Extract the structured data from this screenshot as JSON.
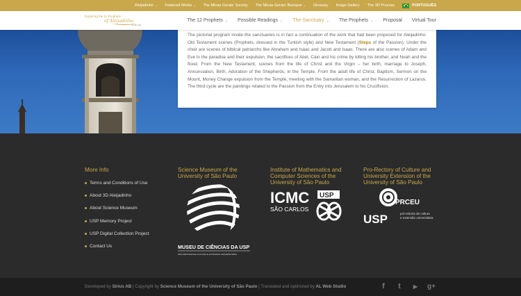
{
  "topbar": {
    "items": [
      {
        "label": "Aleijadinho",
        "caret": "⌄"
      },
      {
        "label": "Featured Works",
        "caret": "⌄"
      },
      {
        "label": "The Minas Gerais' Society",
        "caret": ""
      },
      {
        "label": "The Minas Gerais' Baroque",
        "caret": "⌄"
      },
      {
        "label": "Glossary",
        "caret": ""
      },
      {
        "label": "Image Gallery",
        "caret": ""
      },
      {
        "label": "The 3D Process",
        "caret": ""
      }
    ],
    "language": "PORTUGUÊS"
  },
  "logo": {
    "line1": "Exploring the 12 Prophets",
    "line2": "of Aleijadinho",
    "line3": "in 3D web"
  },
  "nav": {
    "items": [
      {
        "label": "The 12 Prophets",
        "caret": "⌄",
        "active": false
      },
      {
        "label": "Possible Readings",
        "caret": "⌄",
        "active": false
      },
      {
        "label": "The Sanctuary",
        "caret": "⌄",
        "active": true
      },
      {
        "label": "The Prophets",
        "caret": "⌄",
        "active": false
      },
      {
        "label": "Proposal",
        "caret": "",
        "active": false
      },
      {
        "label": "Virtual Tour",
        "caret": "",
        "active": false
      }
    ]
  },
  "content": {
    "before_steps": "The pictorial program inside the sanctuaries is in fact a continuation of the work that had been proposed for Aleijadinho: Old Testament scenes (Prophets, dressed in the Turkish style) and New Testament (",
    "steps": "Steps",
    "after_steps": " of the Passion). Under the choir are scenes of biblical patriarchs like Abraham and Isaac and Jacob and Isaac. There are also scenes of Adam and Eve in the paradise and their expulsion, the sacrifices of Abel, Cain and his crime by killing his brother, and Noah and the flood. From the New Testament, scenes from the life of Christ and the Virgin – her birth, marriage to Joseph, Annunciation, Birth, Adoration of the Shepherds, in the Temple. From the adult life of Christ, Baptism, Sermon on the Mount, Money Change expulsion from the Temple, meeting with the Samaritan woman, and the Resurrection of Lazarus. The third cycle are the paintings related to the Passion from the Entry into Jerusalem to his Crucifixion."
  },
  "footer": {
    "more_info": {
      "title": "More Info",
      "links": [
        "Terms and Conditions of Use",
        "About 3D Aleijadinho",
        "About Science Museum",
        "USP Memory Project",
        "USP Digital Collection Project",
        "Contact Us"
      ]
    },
    "museum": {
      "title": "Science Museum of the University of São Paulo",
      "logo_main": "MUSEU DE CIÊNCIAS DA USP",
      "logo_sub": "PRÓ-REITORIA DE CULTURA E EXTENSÃO UNIVERSITÁRIA"
    },
    "icmc": {
      "title": "Institute of Mathematics and Computer Sciences of the University of São Paulo",
      "logo_main": "ICMC",
      "logo_usp": "USP",
      "logo_sub": "SÃO CARLOS"
    },
    "prceu": {
      "title": "Pro-Rectory of Culture and University Extension of the University of São Paulo",
      "logo_main": "PRCEU",
      "logo_usp": "USP",
      "logo_sub1": "pró-reitoria de cultura",
      "logo_sub2": "e extensão universitária"
    }
  },
  "bottom": {
    "developed_by": "Developed by",
    "developer": "Sirius AB",
    "copyright_by": "| Copyright by",
    "copyright_owner": "Science Museum of the University of São Paulo",
    "translated_by": "| Translated and optimized by",
    "translator": "AL Web Studio",
    "social": [
      {
        "icon": "facebook-icon",
        "glyph": "f"
      },
      {
        "icon": "twitter-icon",
        "glyph": "t"
      },
      {
        "icon": "youtube-icon",
        "glyph": "▶"
      },
      {
        "icon": "google-plus-icon",
        "glyph": "g+"
      }
    ]
  },
  "colors": {
    "accent": "#c9a84c",
    "topbar": "#c9a84c",
    "footer": "#2b2b2b",
    "bottombar": "#1e1e1e",
    "sky": "#2e68b8"
  }
}
